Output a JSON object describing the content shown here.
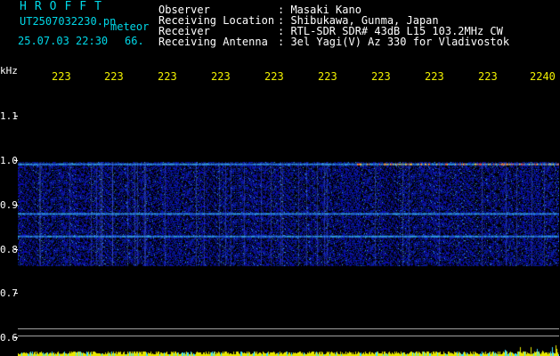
{
  "header": {
    "brand": "HROFFT",
    "filename": "UT2507032230.pn",
    "mode": "meteor",
    "datetime": "25.07.03 22:30",
    "count": "66.",
    "labels": [
      "Observer",
      "Receiving Location",
      "Receiver",
      "Receiving Antenna"
    ],
    "values": [
      ": Masaki Kano",
      ": Shibukawa, Gunma, Japan",
      ": RTL-SDR SDR# 43dB L15 103.2MHz CW",
      ": 3el Yagi(V) Az 330 for Vladivostok"
    ]
  },
  "y_axis": {
    "unit": "kHz",
    "ticks": [
      "1.1",
      "1.0",
      "0.9",
      "0.8",
      "0.7",
      "0.6"
    ]
  },
  "x_axis": {
    "ticks": [
      "223",
      "223",
      "223",
      "223",
      "223",
      "223",
      "223",
      "223",
      "223",
      "2240"
    ]
  },
  "colors": {
    "background": "#000000",
    "header_accent": "#00d8e8",
    "time_labels": "#f0f000",
    "signal_noise": "#0a2cc8",
    "signal_hot": "#ffcc33",
    "baseline": "#e8e800"
  },
  "spectrogram": {
    "band_low_khz": 0.79,
    "band_high_khz": 1.02,
    "carrier_lines_khz": [
      1.015,
      0.905,
      0.855
    ],
    "view_range_khz": [
      0.59,
      1.19
    ]
  }
}
